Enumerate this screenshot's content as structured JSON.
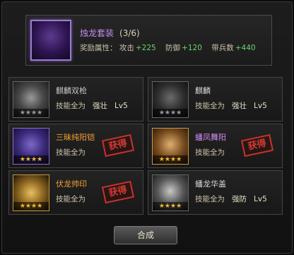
{
  "set": {
    "name": "烛龙套装",
    "count": "(3/6)",
    "bonus_label": "奖励属性",
    "attrs": [
      {
        "label": "攻击",
        "value": "+225"
      },
      {
        "label": "防御",
        "value": "+120"
      },
      {
        "label": "带兵数",
        "value": "+440"
      }
    ]
  },
  "cards": [
    {
      "name": "麒麟双枪",
      "skill_label": "技能全为",
      "skill_value": "强壮",
      "level": "Lv5",
      "stars": "★★★★",
      "obtained": ""
    },
    {
      "name": "麒麟",
      "skill_label": "技能全为",
      "skill_value": "强壮",
      "level": "Lv5",
      "stars": "★★★★",
      "obtained": ""
    },
    {
      "name": "三昧纯阳铠",
      "skill_label": "技能全为",
      "skill_value": "",
      "level": "",
      "stars": "★★★★",
      "obtained": "获得"
    },
    {
      "name": "蟠凤舞阳",
      "skill_label": "技能全为",
      "skill_value": "",
      "level": "",
      "stars": "★★★★",
      "obtained": "获得"
    },
    {
      "name": "伏龙帅印",
      "skill_label": "技能全为",
      "skill_value": "",
      "level": "",
      "stars": "★★★★",
      "obtained": "获得"
    },
    {
      "name": "蟠龙华盖",
      "skill_label": "技能全为",
      "skill_value": "强防",
      "level": "Lv5",
      "stars": "★★★★",
      "obtained": ""
    }
  ],
  "merge_button": "合成"
}
